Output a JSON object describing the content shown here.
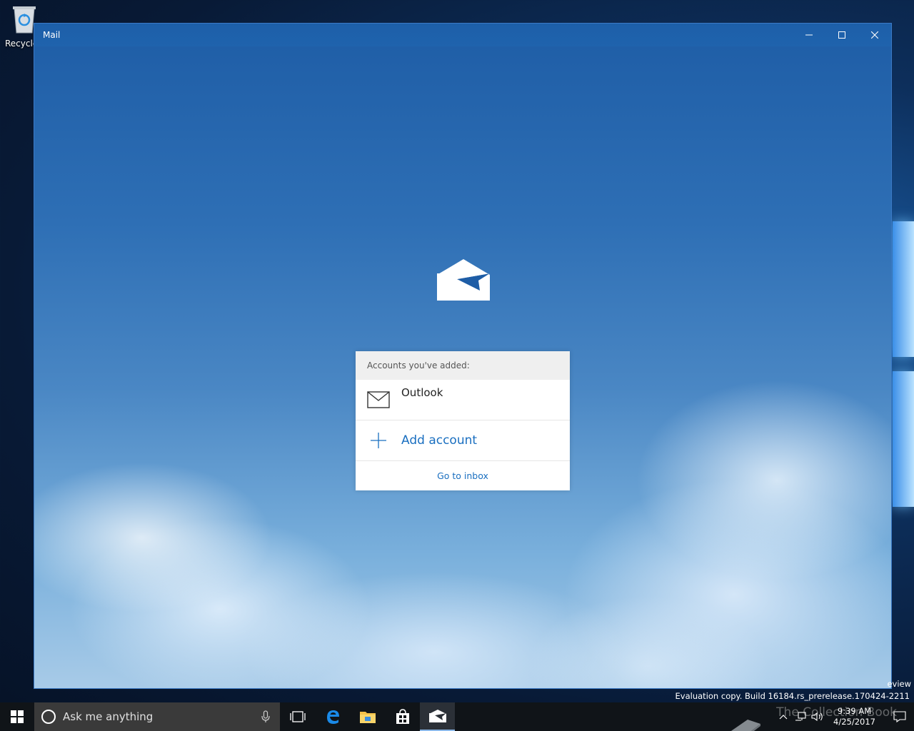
{
  "desktop": {
    "recycle_label": "Recycle"
  },
  "window": {
    "title": "Mail",
    "minimize": "minimize",
    "maximize": "maximize",
    "close": "close"
  },
  "accounts_panel": {
    "header": "Accounts you've added:",
    "accounts": [
      {
        "name": "Outlook",
        "icon": "mail-envelope-icon"
      }
    ],
    "add_account_label": "Add account",
    "go_to_inbox_label": "Go to inbox"
  },
  "watermark": {
    "edition_fragment": "eview",
    "build": "Evaluation copy. Build 16184.rs_prerelease.170424-2211"
  },
  "taskbar": {
    "search_placeholder": "Ask me anything",
    "pinned": [
      "task-view-icon",
      "edge-icon",
      "file-explorer-icon",
      "store-icon",
      "mail-icon"
    ],
    "active_app": "mail-icon",
    "brand_overlay": "The Collection Book",
    "time": "9:39 AM",
    "date": "4/25/2017"
  },
  "colors": {
    "titlebar": "#1f63ad",
    "link": "#1a6fc0",
    "taskbar": "#101418"
  }
}
